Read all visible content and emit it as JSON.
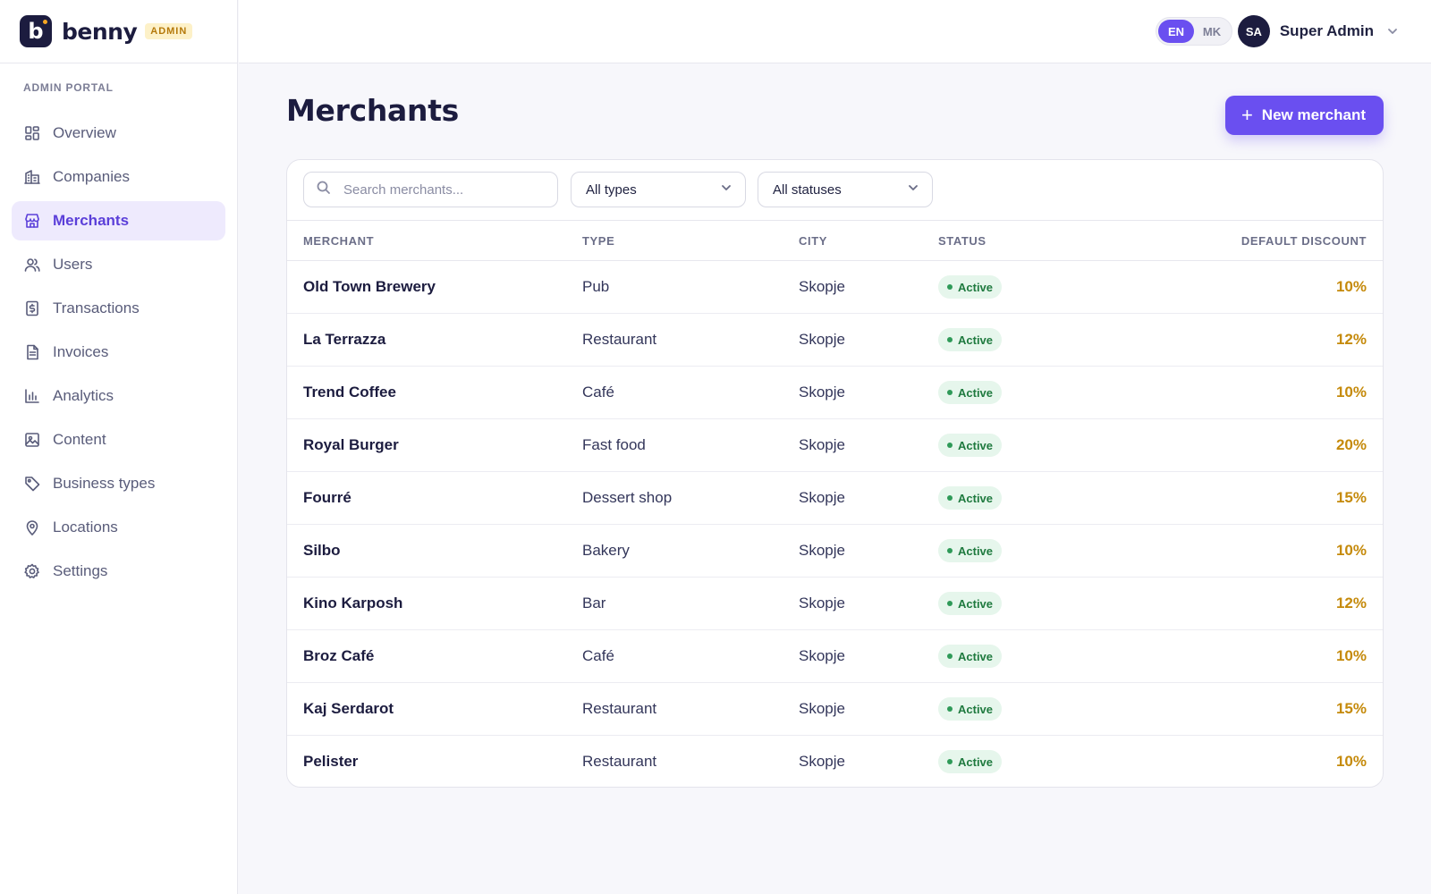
{
  "brand": {
    "name": "benny",
    "logo_letter": "b",
    "badge": "ADMIN"
  },
  "sidebar": {
    "section_label": "ADMIN PORTAL",
    "items": [
      {
        "label": "Overview",
        "icon": "grid-icon",
        "active": false
      },
      {
        "label": "Companies",
        "icon": "building-icon",
        "active": false
      },
      {
        "label": "Merchants",
        "icon": "store-icon",
        "active": true
      },
      {
        "label": "Users",
        "icon": "users-icon",
        "active": false
      },
      {
        "label": "Transactions",
        "icon": "receipt-icon",
        "active": false
      },
      {
        "label": "Invoices",
        "icon": "file-icon",
        "active": false
      },
      {
        "label": "Analytics",
        "icon": "bar-chart-icon",
        "active": false
      },
      {
        "label": "Content",
        "icon": "image-icon",
        "active": false
      },
      {
        "label": "Business types",
        "icon": "tag-icon",
        "active": false
      },
      {
        "label": "Locations",
        "icon": "map-pin-icon",
        "active": false
      },
      {
        "label": "Settings",
        "icon": "gear-icon",
        "active": false
      }
    ]
  },
  "topbar": {
    "languages": [
      {
        "code": "EN",
        "selected": true
      },
      {
        "code": "MK",
        "selected": false
      }
    ],
    "user": {
      "initials": "SA",
      "name": "Super Admin"
    }
  },
  "page": {
    "title": "Merchants",
    "new_button": "New merchant"
  },
  "filters": {
    "search_placeholder": "Search merchants...",
    "type_select": "All types",
    "status_select": "All statuses"
  },
  "table": {
    "columns": [
      "MERCHANT",
      "TYPE",
      "CITY",
      "STATUS",
      "DEFAULT DISCOUNT"
    ],
    "rows": [
      {
        "merchant": "Old Town Brewery",
        "type": "Pub",
        "city": "Skopje",
        "status": "Active",
        "discount": "10%"
      },
      {
        "merchant": "La Terrazza",
        "type": "Restaurant",
        "city": "Skopje",
        "status": "Active",
        "discount": "12%"
      },
      {
        "merchant": "Trend Coffee",
        "type": "Café",
        "city": "Skopje",
        "status": "Active",
        "discount": "10%"
      },
      {
        "merchant": "Royal Burger",
        "type": "Fast food",
        "city": "Skopje",
        "status": "Active",
        "discount": "20%"
      },
      {
        "merchant": "Fourré",
        "type": "Dessert shop",
        "city": "Skopje",
        "status": "Active",
        "discount": "15%"
      },
      {
        "merchant": "Silbo",
        "type": "Bakery",
        "city": "Skopje",
        "status": "Active",
        "discount": "10%"
      },
      {
        "merchant": "Kino Karposh",
        "type": "Bar",
        "city": "Skopje",
        "status": "Active",
        "discount": "12%"
      },
      {
        "merchant": "Broz Café",
        "type": "Café",
        "city": "Skopje",
        "status": "Active",
        "discount": "10%"
      },
      {
        "merchant": "Kaj Serdarot",
        "type": "Restaurant",
        "city": "Skopje",
        "status": "Active",
        "discount": "15%"
      },
      {
        "merchant": "Pelister",
        "type": "Restaurant",
        "city": "Skopje",
        "status": "Active",
        "discount": "10%"
      }
    ]
  },
  "colors": {
    "accent": "#6a4ff0",
    "brand_dark": "#1c1c3f",
    "status_active_bg": "#e6f6ec",
    "status_active_text": "#1f7a3f",
    "discount": "#c58a0b"
  }
}
